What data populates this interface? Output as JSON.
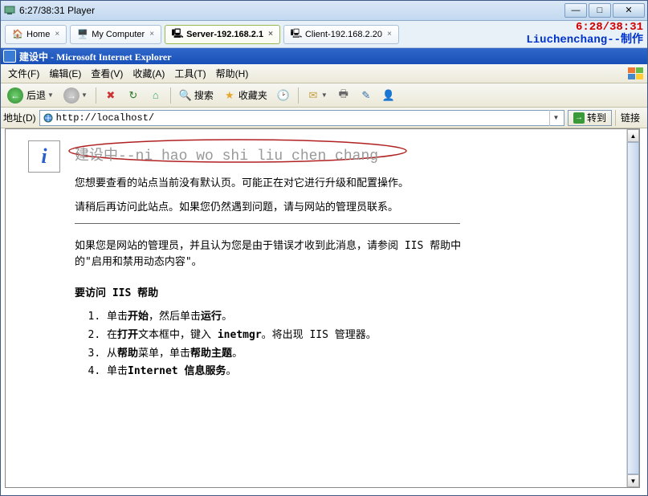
{
  "player": {
    "title": "6:27/38:31 Player",
    "overlay": {
      "time": "6:28/38:31",
      "author": "Liuchenchang--制作"
    }
  },
  "tabs": [
    {
      "icon": "home-icon",
      "label": "Home",
      "active": false
    },
    {
      "icon": "computer-icon",
      "label": "My Computer",
      "active": false
    },
    {
      "icon": "server-icon",
      "label": "Server-192.168.2.1",
      "active": true
    },
    {
      "icon": "client-icon",
      "label": "Client-192.168.2.20",
      "active": false
    }
  ],
  "ie": {
    "title": "建设中 - Microsoft Internet Explorer",
    "menus": {
      "file": "文件(F)",
      "edit": "编辑(E)",
      "view": "查看(V)",
      "favorites": "收藏(A)",
      "tools": "工具(T)",
      "help": "帮助(H)"
    },
    "toolbar": {
      "back": "后退",
      "search": "搜索",
      "favorites": "收藏夹"
    },
    "address": {
      "label": "地址(D)",
      "url": "http://localhost/",
      "go": "转到",
      "links": "链接"
    }
  },
  "page": {
    "info_icon": "i",
    "heading": "建设中--ni hao wo shi liu chen chang",
    "p1": "您想要查看的站点当前没有默认页。可能正在对它进行升级和配置操作。",
    "p2": "请稍后再访问此站点。如果您仍然遇到问题，请与网站的管理员联系。",
    "p3_a": "如果您是网站的管理员，并且认为您是由于错误才收到此消息，请参阅 IIS 帮助中的\"启用和禁用动态内容\"。",
    "subhead": "要访问 IIS 帮助",
    "steps": {
      "s1a": "单击",
      "s1b": "开始",
      "s1c": "，然后单击",
      "s1d": "运行",
      "s1e": "。",
      "s2a": "在",
      "s2b": "打开",
      "s2c": "文本框中，键入 ",
      "s2d": "inetmgr",
      "s2e": "。将出现 IIS 管理器。",
      "s3a": "从",
      "s3b": "帮助",
      "s3c": "菜单，单击",
      "s3d": "帮助主题",
      "s3e": "。",
      "s4a": "单击",
      "s4b": "Internet 信息服务",
      "s4c": "。"
    }
  }
}
